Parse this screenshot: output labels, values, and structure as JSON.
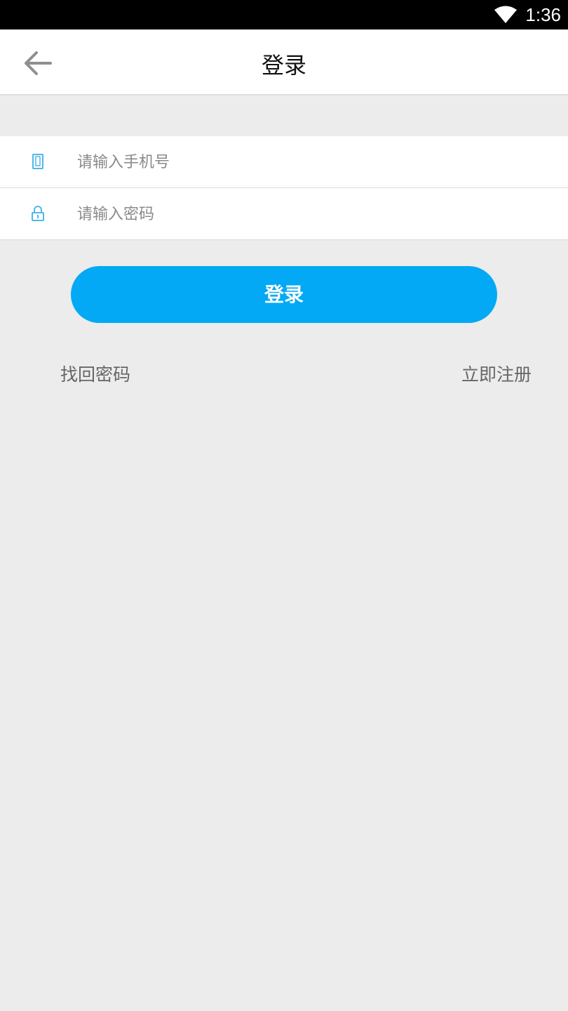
{
  "status_bar": {
    "time": "1:36",
    "wifi_icon": "wifi-icon"
  },
  "app_bar": {
    "back_icon": "arrow-left-icon",
    "title": "登录"
  },
  "form": {
    "phone": {
      "icon": "phone-icon",
      "placeholder": "请输入手机号",
      "value": ""
    },
    "password": {
      "icon": "lock-icon",
      "placeholder": "请输入密码",
      "value": ""
    }
  },
  "login_button": {
    "label": "登录"
  },
  "links": {
    "forgot_password": "找回密码",
    "register": "立即注册"
  },
  "colors": {
    "accent": "#03a9f4",
    "background": "#ececec",
    "icon": "#4fb8e6"
  }
}
